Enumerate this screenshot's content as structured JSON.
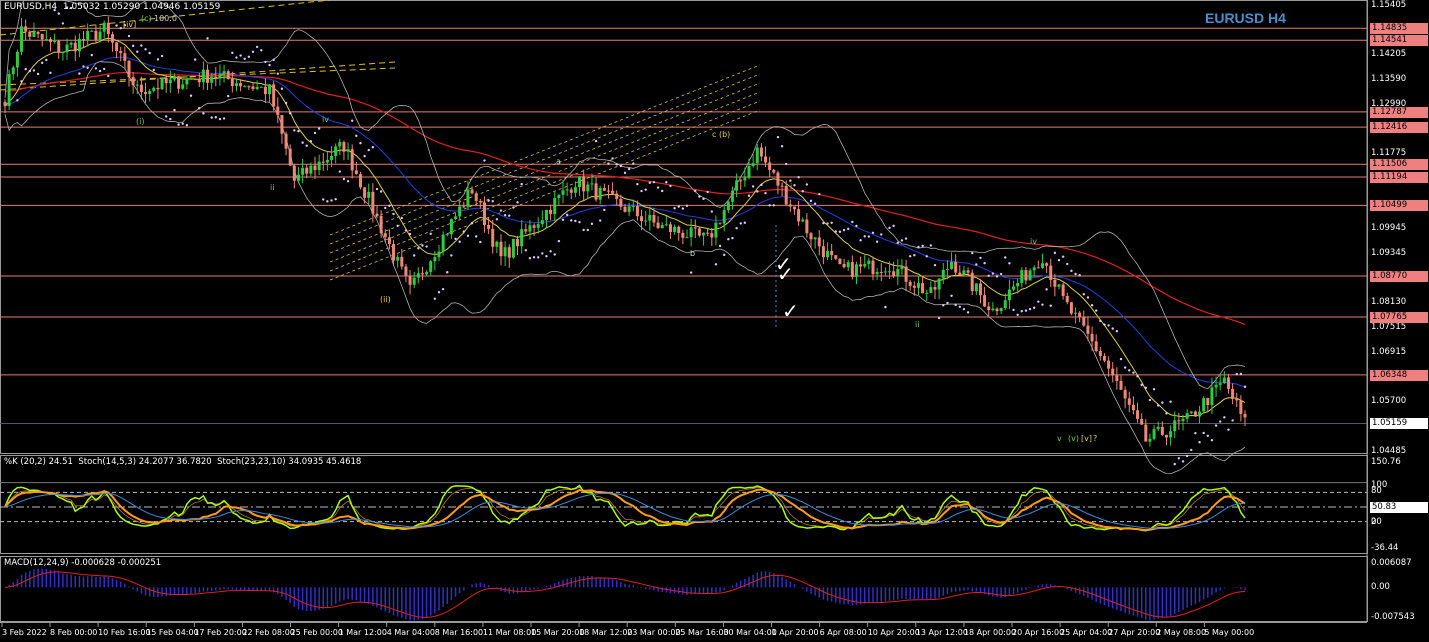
{
  "header": {
    "symbol_timeframe": "EURUSD,H4",
    "open": "1.05032",
    "high": "1.05290",
    "low": "1.04946",
    "close": "1.05159"
  },
  "chart_title": "EURUSD H4",
  "colors": {
    "bull": "#2ecc40",
    "bear": "#f08878",
    "level_line": "#e08070",
    "level_box": "#f08080",
    "ma200": "#e02020",
    "ma50": "#2040e0",
    "ma21": "#e0d040",
    "bands": "#b0b0b0",
    "sar": "#e0c8ff",
    "stoch_fast": "#aaff00",
    "stoch_slow": "#ff9a1a",
    "stoch_blue": "#3a8ad8",
    "macd_hist": "#3030c8",
    "macd_signal": "#e02020"
  },
  "price_axis": {
    "max": 1.15405,
    "min": 1.04485,
    "ticks": [
      "1.15405",
      "1.14205",
      "1.13590",
      "1.12990",
      "1.11775",
      "1.09945",
      "1.09345",
      "1.08130",
      "1.07515",
      "1.06915",
      "1.05700",
      "1.04485"
    ],
    "levels": [
      "1.14835",
      "1.14541",
      "1.12787",
      "1.12416",
      "1.11506",
      "1.11194",
      "1.10499",
      "1.08770",
      "1.07765",
      "1.06348"
    ],
    "current_price": "1.05159"
  },
  "chart_data": {
    "type": "candlestick",
    "bars": 300,
    "close_anchors": [
      [
        0,
        1.1313
      ],
      [
        4,
        1.1479
      ],
      [
        14,
        1.143
      ],
      [
        24,
        1.148
      ],
      [
        32,
        1.1332
      ],
      [
        50,
        1.137
      ],
      [
        64,
        1.133
      ],
      [
        70,
        1.111
      ],
      [
        82,
        1.1197
      ],
      [
        98,
        1.084
      ],
      [
        113,
        1.109
      ],
      [
        120,
        1.092
      ],
      [
        138,
        1.111
      ],
      [
        158,
        1.1
      ],
      [
        170,
        1.0965
      ],
      [
        182,
        1.1185
      ],
      [
        194,
        1.099
      ],
      [
        202,
        1.089
      ],
      [
        214,
        1.0905
      ],
      [
        224,
        1.083
      ],
      [
        229,
        1.0915
      ],
      [
        239,
        1.0793
      ],
      [
        251,
        1.0928
      ],
      [
        256,
        1.0817
      ],
      [
        266,
        1.067
      ],
      [
        276,
        1.0474
      ],
      [
        286,
        1.0523
      ],
      [
        295,
        1.062
      ],
      [
        300,
        1.0516
      ]
    ]
  },
  "stoch_panel": {
    "label": "%K (20,2) 24.51  Stoch(14,5,3) 24.2077 36.7820  Stoch(23,23,10) 34.0935 45.4618",
    "max": "150.76",
    "min": "-36.44",
    "level_80": "80",
    "level_100": "100",
    "level_20": "20",
    "level_0": "0",
    "current": "50.83"
  },
  "macd_panel": {
    "label": "MACD(12,24,9) -0.000628 -0.000251",
    "max": "0.006087",
    "zero": "0.00",
    "min": "-0.007543"
  },
  "time_axis": [
    "3 Feb 2022",
    "8 Feb 00:00",
    "10 Feb 16:00",
    "15 Feb 04:00",
    "17 Feb 20:00",
    "22 Feb 08:00",
    "25 Feb 00:00",
    "1 Mar 12:00",
    "4 Mar 04:00",
    "8 Mar 16:00",
    "11 Mar 08:00",
    "15 Mar 20:00",
    "18 Mar 12:00",
    "23 Mar 00:00",
    "25 Mar 16:00",
    "30 Mar 04:00",
    "1 Apr 20:00",
    "6 Apr 08:00",
    "10 Apr 20:00",
    "13 Apr 12:00",
    "18 Apr 00:00",
    "20 Apr 16:00",
    "25 Apr 04:00",
    "27 Apr 20:00",
    "2 May 08:00",
    "5 May 00:00"
  ],
  "wave_labels": [
    "[iv]",
    "(c)",
    "100.0",
    "(i)",
    "iv",
    "ii",
    "a",
    "b",
    "c (b)",
    "i",
    "ii",
    "iv",
    "v",
    "(v)",
    "[v]",
    "?",
    "(ii)"
  ]
}
